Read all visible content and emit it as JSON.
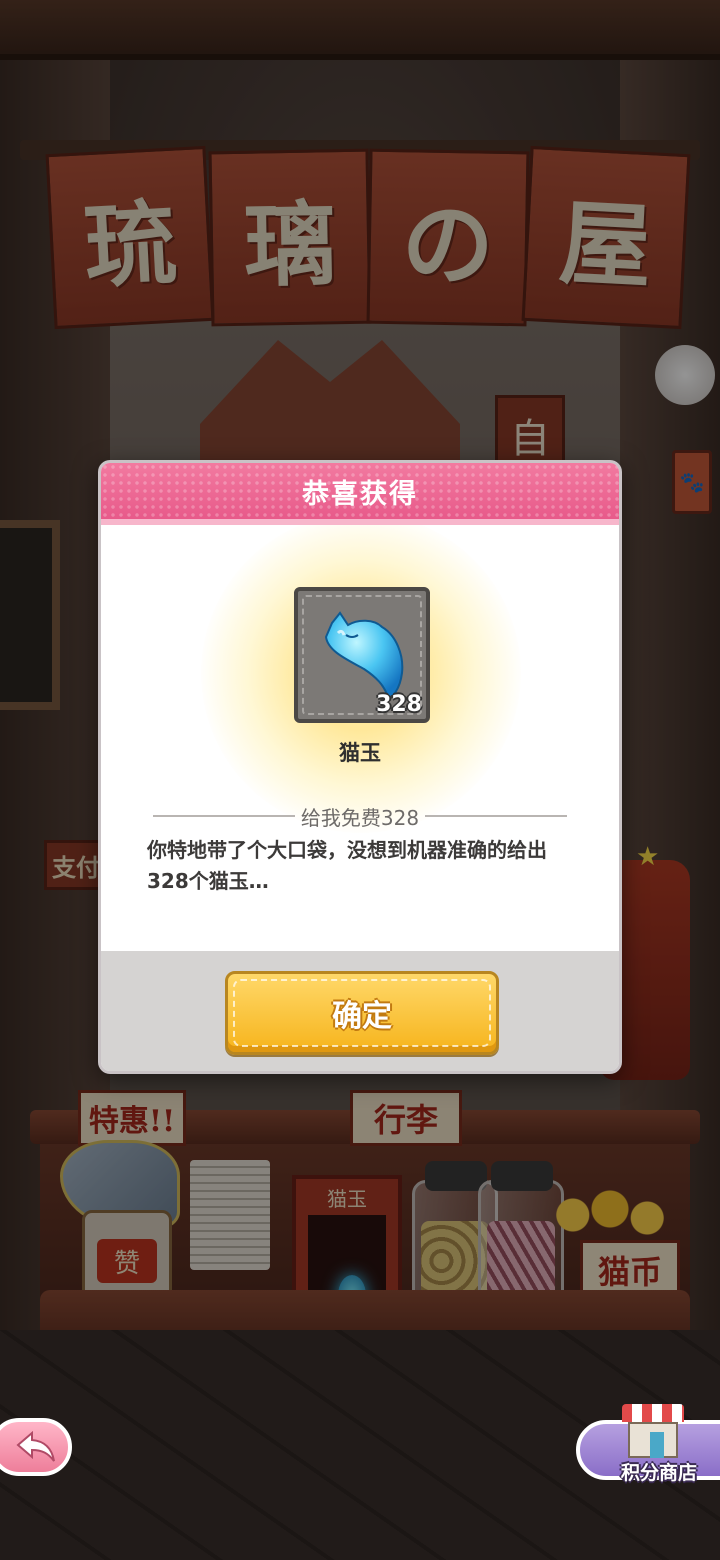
{
  "scene": {
    "shop_sign_chars": [
      "琉",
      "璃",
      "の",
      "屋"
    ],
    "side_sign": "自",
    "shelf_labels": {
      "special": "特惠!!",
      "luggage": "行李",
      "cat_jade": "猫玉",
      "cat_coin": "猫币",
      "can": "赞",
      "pay": "支付"
    }
  },
  "dialog": {
    "title": "恭喜获得",
    "item": {
      "icon": "blue-cat-jade-icon",
      "count": "328",
      "name": "猫玉"
    },
    "subtitle": "给我免费328",
    "description": "你特地带了个大口袋，没想到机器准确的给出328个猫玉…",
    "confirm_label": "确定"
  },
  "bottom_bar": {
    "back_icon": "back-arrow-icon",
    "shop_label": "积分商店",
    "shop_icon": "storefront-icon"
  },
  "colors": {
    "header_pink": "#e85a8a",
    "confirm_yellow": "#f6b41c",
    "back_pink": "#ee7e9a",
    "shop_purple": "#8a6ec8"
  }
}
